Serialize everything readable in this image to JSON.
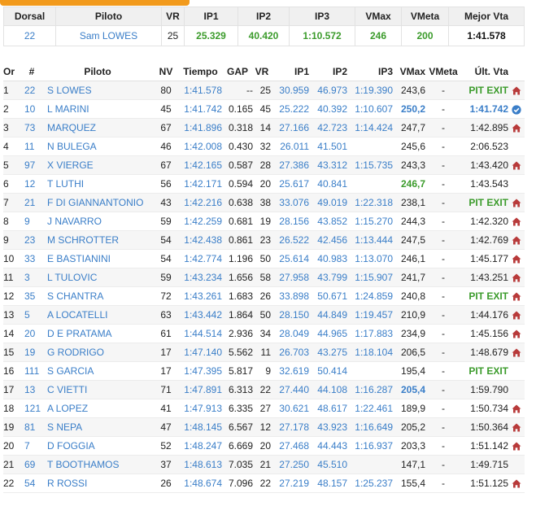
{
  "rider_summary": {
    "headers": [
      "Dorsal",
      "Piloto",
      "VR",
      "IP1",
      "IP2",
      "IP3",
      "VMax",
      "VMeta",
      "Mejor Vta"
    ],
    "row": {
      "dorsal": "22",
      "piloto": "Sam LOWES",
      "vr": "25",
      "ip1": "25.329",
      "ip2": "40.420",
      "ip3": "1:10.572",
      "vmax": "246",
      "vmeta": "200",
      "mejor_vta": "1:41.578"
    }
  },
  "standings": {
    "headers": [
      "Or",
      "#",
      "Piloto",
      "NV",
      "Tiempo",
      "GAP",
      "VR",
      "IP1",
      "IP2",
      "IP3",
      "VMax",
      "VMeta",
      "Últ. Vta"
    ],
    "icon_legend": {
      "house": "home-icon",
      "check": "check-circle-icon"
    },
    "rows": [
      {
        "or": "1",
        "num": "22",
        "piloto": "S LOWES",
        "nv": "80",
        "tiempo": "1:41.578",
        "gap": "--",
        "vr": "25",
        "ip1": "30.959",
        "ip2": "46.973",
        "ip3": "1:19.390",
        "vmax": "243,6",
        "vmeta": "-",
        "ult": "PIT EXIT",
        "ult_style": "pit",
        "icon": "house"
      },
      {
        "or": "2",
        "num": "10",
        "piloto": "L MARINI",
        "nv": "45",
        "tiempo": "1:41.742",
        "gap": "0.165",
        "vr": "45",
        "ip1": "25.222",
        "ip2": "40.392",
        "ip3": "1:10.607",
        "vmax": "250,2",
        "vmax_style": "bold",
        "vmeta": "-",
        "ult": "1:41.742",
        "ult_style": "best",
        "icon": "check"
      },
      {
        "or": "3",
        "num": "73",
        "piloto": "MARQUEZ",
        "nv": "67",
        "tiempo": "1:41.896",
        "gap": "0.318",
        "vr": "14",
        "ip1": "27.166",
        "ip2": "42.723",
        "ip3": "1:14.424",
        "vmax": "247,7",
        "vmeta": "-",
        "ult": "1:42.895",
        "icon": "house"
      },
      {
        "or": "4",
        "num": "11",
        "piloto": "N BULEGA",
        "nv": "46",
        "tiempo": "1:42.008",
        "gap": "0.430",
        "vr": "32",
        "ip1": "26.011",
        "ip2": "41.501",
        "ip3": "",
        "vmax": "245,6",
        "vmeta": "-",
        "ult": "2:06.523",
        "icon": ""
      },
      {
        "or": "5",
        "num": "97",
        "piloto": "X VIERGE",
        "nv": "67",
        "tiempo": "1:42.165",
        "gap": "0.587",
        "vr": "28",
        "ip1": "27.386",
        "ip2": "43.312",
        "ip3": "1:15.735",
        "vmax": "243,3",
        "vmeta": "-",
        "ult": "1:43.420",
        "icon": "house"
      },
      {
        "or": "6",
        "num": "12",
        "piloto": "T LUTHI",
        "nv": "56",
        "tiempo": "1:42.171",
        "gap": "0.594",
        "vr": "20",
        "ip1": "25.617",
        "ip2": "40.841",
        "ip3": "",
        "vmax": "246,7",
        "vmax_style": "green",
        "vmeta": "-",
        "ult": "1:43.543",
        "icon": ""
      },
      {
        "or": "7",
        "num": "21",
        "piloto": "F DI GIANNANTONIO",
        "nv": "43",
        "tiempo": "1:42.216",
        "gap": "0.638",
        "vr": "38",
        "ip1": "33.076",
        "ip2": "49.019",
        "ip3": "1:22.318",
        "vmax": "238,1",
        "vmeta": "-",
        "ult": "PIT EXIT",
        "ult_style": "pit",
        "icon": "house"
      },
      {
        "or": "8",
        "num": "9",
        "piloto": "J NAVARRO",
        "nv": "59",
        "tiempo": "1:42.259",
        "gap": "0.681",
        "vr": "19",
        "ip1": "28.156",
        "ip2": "43.852",
        "ip3": "1:15.270",
        "vmax": "244,3",
        "vmeta": "-",
        "ult": "1:42.320",
        "icon": "house"
      },
      {
        "or": "9",
        "num": "23",
        "piloto": "M SCHROTTER",
        "nv": "54",
        "tiempo": "1:42.438",
        "gap": "0.861",
        "vr": "23",
        "ip1": "26.522",
        "ip2": "42.456",
        "ip3": "1:13.444",
        "vmax": "247,5",
        "vmeta": "-",
        "ult": "1:42.769",
        "icon": "house"
      },
      {
        "or": "10",
        "num": "33",
        "piloto": "E BASTIANINI",
        "nv": "54",
        "tiempo": "1:42.774",
        "gap": "1.196",
        "vr": "50",
        "ip1": "25.614",
        "ip2": "40.983",
        "ip3": "1:13.070",
        "vmax": "246,1",
        "vmeta": "-",
        "ult": "1:45.177",
        "icon": "house"
      },
      {
        "or": "11",
        "num": "3",
        "piloto": "L TULOVIC",
        "nv": "59",
        "tiempo": "1:43.234",
        "gap": "1.656",
        "vr": "58",
        "ip1": "27.958",
        "ip2": "43.799",
        "ip3": "1:15.907",
        "vmax": "241,7",
        "vmeta": "-",
        "ult": "1:43.251",
        "icon": "house"
      },
      {
        "or": "12",
        "num": "35",
        "piloto": "S CHANTRA",
        "nv": "72",
        "tiempo": "1:43.261",
        "gap": "1.683",
        "vr": "26",
        "ip1": "33.898",
        "ip2": "50.671",
        "ip3": "1:24.859",
        "vmax": "240,8",
        "vmeta": "-",
        "ult": "PIT EXIT",
        "ult_style": "pit",
        "icon": "house"
      },
      {
        "or": "13",
        "num": "5",
        "piloto": "A LOCATELLI",
        "nv": "63",
        "tiempo": "1:43.442",
        "gap": "1.864",
        "vr": "50",
        "ip1": "28.150",
        "ip2": "44.849",
        "ip3": "1:19.457",
        "vmax": "210,9",
        "vmeta": "-",
        "ult": "1:44.176",
        "icon": "house"
      },
      {
        "or": "14",
        "num": "20",
        "piloto": "D E PRATAMA",
        "nv": "61",
        "tiempo": "1:44.514",
        "gap": "2.936",
        "vr": "34",
        "ip1": "28.049",
        "ip2": "44.965",
        "ip3": "1:17.883",
        "vmax": "234,9",
        "vmeta": "-",
        "ult": "1:45.156",
        "icon": "house"
      },
      {
        "or": "15",
        "num": "19",
        "piloto": "G RODRIGO",
        "nv": "17",
        "tiempo": "1:47.140",
        "gap": "5.562",
        "vr": "11",
        "ip1": "26.703",
        "ip2": "43.275",
        "ip3": "1:18.104",
        "vmax": "206,5",
        "vmeta": "-",
        "ult": "1:48.679",
        "icon": "house"
      },
      {
        "or": "16",
        "num": "111",
        "piloto": "S GARCIA",
        "nv": "17",
        "tiempo": "1:47.395",
        "gap": "5.817",
        "vr": "9",
        "ip1": "32.619",
        "ip2": "50.414",
        "ip3": "",
        "vmax": "195,4",
        "vmeta": "-",
        "ult": "PIT EXIT",
        "ult_style": "pit",
        "icon": ""
      },
      {
        "or": "17",
        "num": "13",
        "piloto": "C VIETTI",
        "nv": "71",
        "tiempo": "1:47.891",
        "gap": "6.313",
        "vr": "22",
        "ip1": "27.440",
        "ip2": "44.108",
        "ip3": "1:16.287",
        "vmax": "205,4",
        "vmax_style": "bold",
        "vmeta": "-",
        "ult": "1:59.790",
        "icon": ""
      },
      {
        "or": "18",
        "num": "121",
        "piloto": "A LOPEZ",
        "nv": "41",
        "tiempo": "1:47.913",
        "gap": "6.335",
        "vr": "27",
        "ip1": "30.621",
        "ip2": "48.617",
        "ip3": "1:22.461",
        "vmax": "189,9",
        "vmeta": "-",
        "ult": "1:50.734",
        "icon": "house"
      },
      {
        "or": "19",
        "num": "81",
        "piloto": "S NEPA",
        "nv": "47",
        "tiempo": "1:48.145",
        "gap": "6.567",
        "vr": "12",
        "ip1": "27.178",
        "ip2": "43.923",
        "ip3": "1:16.649",
        "vmax": "205,2",
        "vmeta": "-",
        "ult": "1:50.364",
        "icon": "house"
      },
      {
        "or": "20",
        "num": "7",
        "piloto": "D FOGGIA",
        "nv": "52",
        "tiempo": "1:48.247",
        "gap": "6.669",
        "vr": "20",
        "ip1": "27.468",
        "ip2": "44.443",
        "ip3": "1:16.937",
        "vmax": "203,3",
        "vmeta": "-",
        "ult": "1:51.142",
        "icon": "house"
      },
      {
        "or": "21",
        "num": "69",
        "piloto": "T BOOTHAMOS",
        "nv": "37",
        "tiempo": "1:48.613",
        "gap": "7.035",
        "vr": "21",
        "ip1": "27.250",
        "ip2": "45.510",
        "ip3": "",
        "vmax": "147,1",
        "vmeta": "-",
        "ult": "1:49.715",
        "icon": ""
      },
      {
        "or": "22",
        "num": "54",
        "piloto": "R ROSSI",
        "nv": "26",
        "tiempo": "1:48.674",
        "gap": "7.096",
        "vr": "22",
        "ip1": "27.219",
        "ip2": "48.157",
        "ip3": "1:25.237",
        "vmax": "155,4",
        "vmeta": "-",
        "ult": "1:51.125",
        "icon": "house"
      }
    ]
  },
  "colors": {
    "accent_tab": "#f29a1c",
    "link_blue": "#3a7ec8",
    "green": "#3b9b2b",
    "icon_red": "#b83a3a"
  }
}
